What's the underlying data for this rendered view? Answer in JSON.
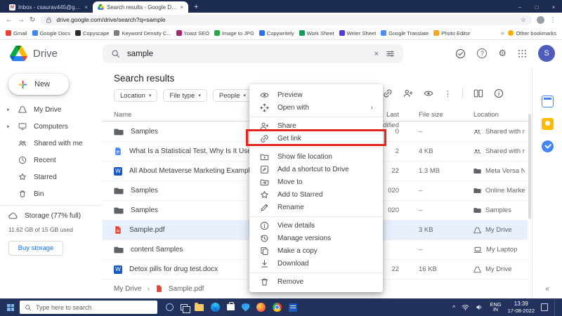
{
  "colors": {
    "annotation_red": "#df251d",
    "selected_row": "#e8f0fe",
    "accent_blue": "#1a73e8",
    "navy_tabstrip": "#1b2b4f",
    "navy_taskbar": "#22325c",
    "avatar_bg": "#4d5cbd"
  },
  "icons": {
    "caret_down": "▾",
    "more_vertical": "⋮",
    "submenu_arrow": "›",
    "breadcrumb_sep": "›",
    "collapse_panel": "«",
    "new_tab_plus": "+",
    "back": "←",
    "forward": "→",
    "refresh": "↻",
    "star_outline": "☆",
    "bookmarks_overflow": "»",
    "window_min": "–",
    "window_max": "□",
    "window_close": "×",
    "tab_close": "×",
    "clear_search": "×",
    "question_mark": "?",
    "gear": "⚙",
    "gmail_m": "M",
    "word_letter": "W",
    "expander": "▸",
    "tray_chevron": "^"
  },
  "browser": {
    "tabs": [
      {
        "title": "Inbox - csaurav445@gmail.com..."
      },
      {
        "title": "Search results - Google Drive"
      }
    ],
    "url": "drive.google.com/drive/search?q=sample",
    "bookmarks": [
      "Gmail",
      "Google Docs",
      "Copyscape",
      "Keyword Density C...",
      "Yoast SEO",
      "Image to JPG",
      "Copywritely",
      "Work Sheet",
      "Writer Sheet",
      "Google Translate",
      "Photo Editor"
    ],
    "other_bookmarks_label": "Other bookmarks"
  },
  "header": {
    "app_name": "Drive",
    "search_value": "sample",
    "avatar_initial": "S"
  },
  "sidebar": {
    "new_label": "New",
    "items": [
      "My Drive",
      "Computers",
      "Shared with me",
      "Recent",
      "Starred",
      "Bin"
    ],
    "storage": {
      "title": "Storage (77% full)",
      "usage": "11.62 GB of 15 GB used",
      "buy_label": "Buy storage"
    }
  },
  "main": {
    "title": "Search results",
    "filters": [
      "Location",
      "File type",
      "People"
    ],
    "columns": {
      "name": "Name",
      "modified": "Last modified",
      "size": "File size",
      "location": "Location"
    },
    "rows": [
      {
        "name": "Samples",
        "modified": "0",
        "size": "–",
        "location": "Shared with me"
      },
      {
        "name": "What Is a Statistical Test, Why Is It Used, and Give...",
        "modified": "2",
        "size": "4 KB",
        "location": "Shared with me"
      },
      {
        "name": "All About Metaverse Marketing Example, Strategi...",
        "modified": "22",
        "size": "1.3 MB",
        "location": "Meta Versa NFT"
      },
      {
        "name": "Samples",
        "modified": "020",
        "size": "–",
        "location": "Online Market..."
      },
      {
        "name": "Samples",
        "modified": "020",
        "size": "–",
        "location": "Samples"
      },
      {
        "name": "Sample.pdf",
        "modified": "",
        "size": "3 KB",
        "location": "My Drive"
      },
      {
        "name": "content Samples",
        "modified": "",
        "size": "–",
        "location": "My Laptop"
      },
      {
        "name": "Detox pills for drug test.docx",
        "modified": "22",
        "size": "16 KB",
        "location": "My Drive"
      }
    ],
    "breadcrumb": {
      "root": "My Drive",
      "file": "Sample.pdf"
    }
  },
  "menu": {
    "items": [
      "Preview",
      "Open with",
      "Share",
      "Get link",
      "Show file location",
      "Add a shortcut to Drive",
      "Move to",
      "Add to Starred",
      "Rename",
      "View details",
      "Manage versions",
      "Make a copy",
      "Download",
      "Remove"
    ]
  },
  "taskbar": {
    "search_placeholder": "Type here to search",
    "lang_primary": "ENG",
    "lang_secondary": "IN",
    "time": "13:39",
    "date": "17-08-2022"
  }
}
